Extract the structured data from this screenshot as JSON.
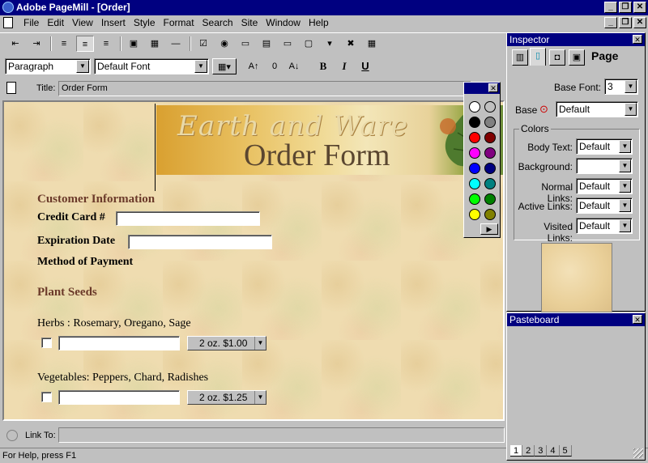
{
  "window": {
    "title": "Adobe PageMill - [Order]"
  },
  "menu": [
    "File",
    "Edit",
    "View",
    "Insert",
    "Style",
    "Format",
    "Search",
    "Site",
    "Window",
    "Help"
  ],
  "format_bar": {
    "paragraph_style": "Paragraph",
    "font": "Default Font",
    "zero_glyph": "0",
    "bold": "B",
    "italic": "I",
    "underline": "U"
  },
  "title_row": {
    "label": "Title:",
    "value": "Order Form"
  },
  "banner": {
    "line1": "Earth and Ware",
    "line2": "Order Form"
  },
  "form": {
    "section1": "Customer Information",
    "credit_card_label": "Credit Card #",
    "expiration_label": "Expiration Date",
    "payment_label": "Method of Payment",
    "section2": "Plant Seeds",
    "herbs_label": "Herbs : Rosemary, Oregano, Sage",
    "herbs_option": "2 oz. $1.00",
    "veg_label": "Vegetables: Peppers, Chard, Radishes",
    "veg_option": "2 oz. $1.25"
  },
  "palette_colors": [
    [
      "#ffffff",
      "#c0c0c0"
    ],
    [
      "#000000",
      "#808080"
    ],
    [
      "#ff0000",
      "#800000"
    ],
    [
      "#ff00ff",
      "#800080"
    ],
    [
      "#0000ff",
      "#000080"
    ],
    [
      "#00ffff",
      "#008080"
    ],
    [
      "#00ff00",
      "#008000"
    ],
    [
      "#ffff00",
      "#808000"
    ]
  ],
  "link_bar": {
    "label": "Link To:"
  },
  "status": "For Help, press F1",
  "inspector": {
    "title": "Inspector",
    "tab_label": "Page",
    "base_font_label": "Base Font:",
    "base_font_value": "3",
    "base_label": "Base",
    "base_value": "Default",
    "colors_label": "Colors",
    "body_text_label": "Body Text:",
    "body_text_value": "Default",
    "background_label": "Background:",
    "background_value": "",
    "normal_links_label": "Normal Links:",
    "normal_links_value": "Default",
    "active_links_label": "Active Links:",
    "active_links_value": "Default",
    "visited_links_label": "Visited Links:",
    "visited_links_value": "Default"
  },
  "pasteboard": {
    "title": "Pasteboard",
    "tabs": [
      "1",
      "2",
      "3",
      "4",
      "5"
    ]
  }
}
